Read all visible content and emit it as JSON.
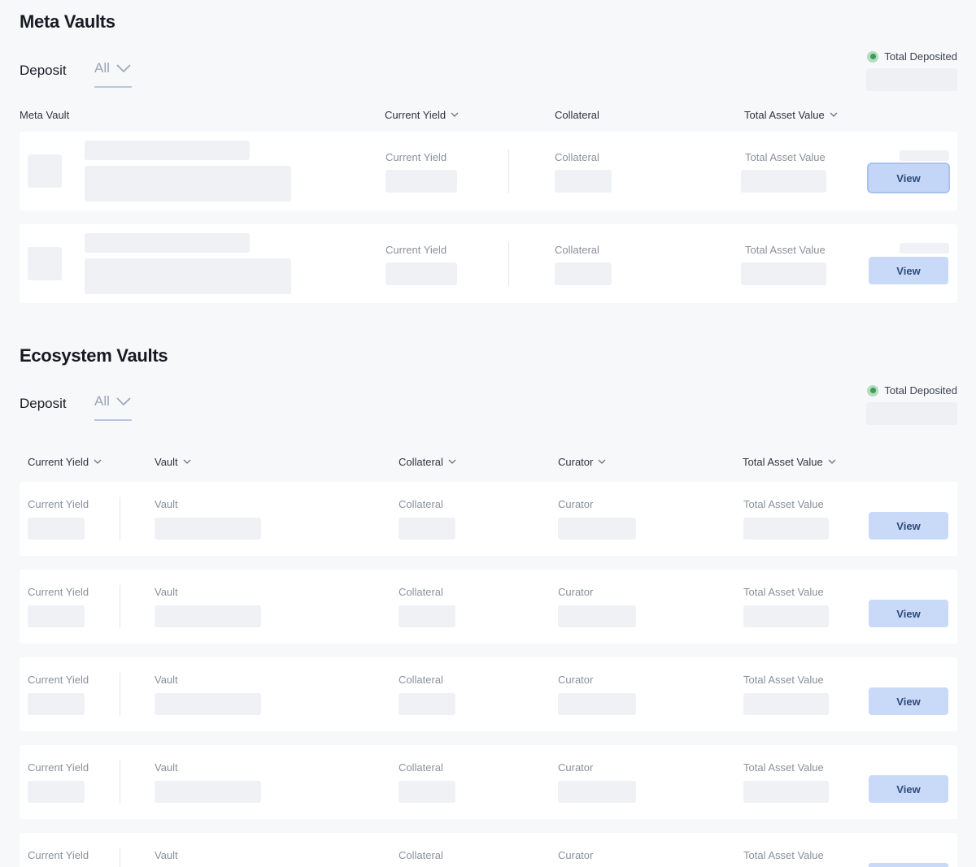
{
  "meta": {
    "title": "Meta Vaults",
    "deposit_label": "Deposit",
    "filter_value": "All",
    "total_deposited_label": "Total Deposited",
    "headers": {
      "meta_vault": "Meta Vault",
      "current_yield": "Current Yield",
      "collateral": "Collateral",
      "total_asset_value": "Total Asset Value"
    },
    "row_labels": {
      "current_yield": "Current Yield",
      "collateral": "Collateral",
      "total_asset_value": "Total Asset Value"
    },
    "view_label": "View"
  },
  "ecosystem": {
    "title": "Ecosystem Vaults",
    "deposit_label": "Deposit",
    "filter_value": "All",
    "total_deposited_label": "Total Deposited",
    "headers": {
      "current_yield": "Current Yield",
      "vault": "Vault",
      "collateral": "Collateral",
      "curator": "Curator",
      "total_asset_value": "Total Asset Value"
    },
    "row_labels": {
      "current_yield": "Current Yield",
      "vault": "Vault",
      "collateral": "Collateral",
      "curator": "Curator",
      "total_asset_value": "Total Asset Value"
    },
    "view_label": "View"
  },
  "icons": {
    "dropdown": "chevron-down-icon",
    "status": "status-dot-icon"
  },
  "colors": {
    "status_dot": "#3e9d59",
    "view_button_bg": "#c9daf8",
    "view_button_text": "#2f4b7a",
    "skeleton": "#f0f1f4"
  }
}
